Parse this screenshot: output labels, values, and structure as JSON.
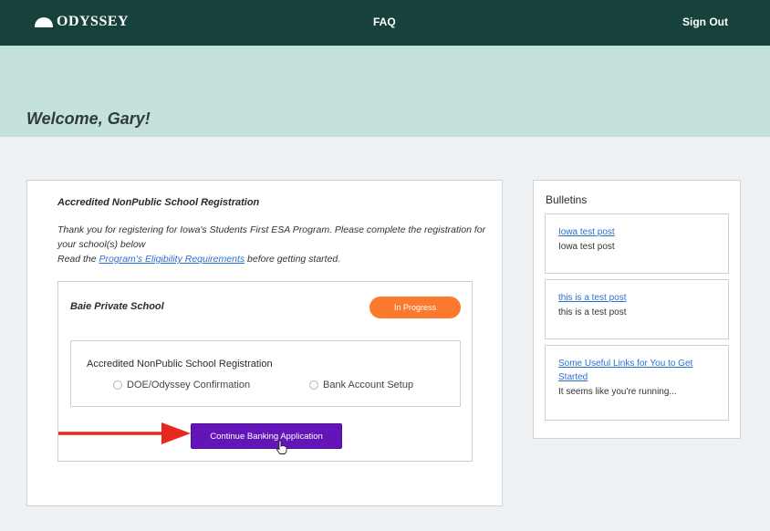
{
  "header": {
    "logo_text": "ODYSSEY",
    "nav": {
      "faq": "FAQ",
      "sign_out": "Sign Out"
    }
  },
  "hero": {
    "welcome": "Welcome, Gary!"
  },
  "registration": {
    "title": "Accredited NonPublic School Registration",
    "intro_line1": "Thank you for registering for Iowa's Students First ESA Program. Please complete the registration for your school(s) below",
    "intro_read": "Read the ",
    "intro_link": "Program's Eligibility Requirements",
    "intro_after": " before getting started.",
    "school": {
      "name": "Baie Private School",
      "status": "In Progress",
      "status_color": "#fb7a2e",
      "box_title": "Accredited NonPublic School Registration",
      "steps": [
        "DOE/Odyssey Confirmation",
        "Bank Account Setup"
      ],
      "continue_label": "Continue Banking Application"
    }
  },
  "bulletins": {
    "title": "Bulletins",
    "items": [
      {
        "link": "Iowa test post",
        "body": "Iowa test post"
      },
      {
        "link": "this is a test post",
        "body": "this is a test post"
      },
      {
        "link": "Some Useful Links for You to Get Started",
        "body": "It seems like you're running..."
      }
    ]
  },
  "colors": {
    "topbar": "#17413b",
    "hero": "#c5e1dc",
    "button": "#6315b8",
    "annotation_arrow": "#e8281c",
    "link": "#2a6fd6"
  },
  "icons": {
    "annotation": "red-arrow-icon",
    "pointer": "hand-cursor-icon"
  }
}
